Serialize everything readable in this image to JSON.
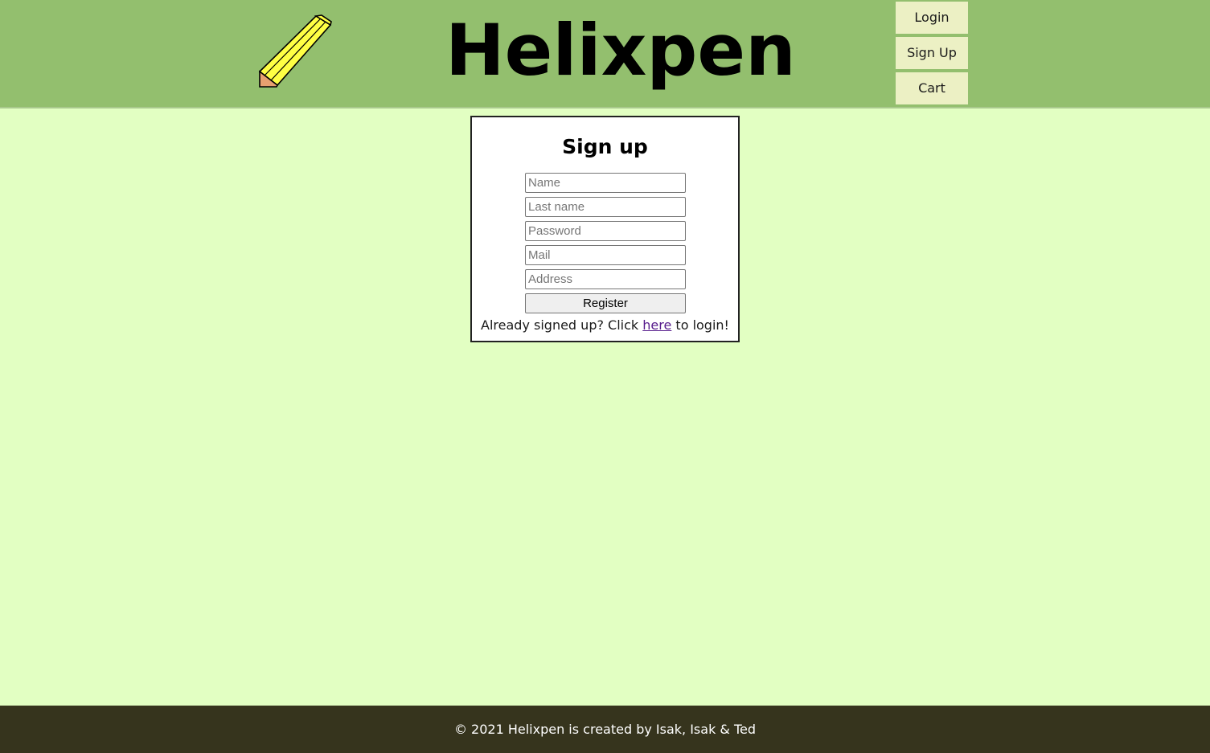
{
  "header": {
    "title": "Helixpen",
    "logo_icon": "pencil-icon",
    "nav": {
      "login_label": "Login",
      "signup_label": "Sign Up",
      "cart_label": "Cart"
    }
  },
  "signup_form": {
    "heading": "Sign up",
    "name_placeholder": "Name",
    "last_name_placeholder": "Last name",
    "password_placeholder": "Password",
    "mail_placeholder": "Mail",
    "address_placeholder": "Address",
    "register_label": "Register",
    "login_prompt_before": "Already signed up? Click ",
    "login_link_text": "here",
    "login_prompt_after": " to login!"
  },
  "footer": {
    "text": "© 2021 Helixpen is created by Isak, Isak & Ted"
  },
  "colors": {
    "header_bg": "#93bf6e",
    "page_bg": "#e2ffc2",
    "nav_button_bg": "#ecf0c4",
    "footer_bg": "#36341d",
    "pencil_body": "#ffff44",
    "pencil_tip": "#e8a070"
  }
}
